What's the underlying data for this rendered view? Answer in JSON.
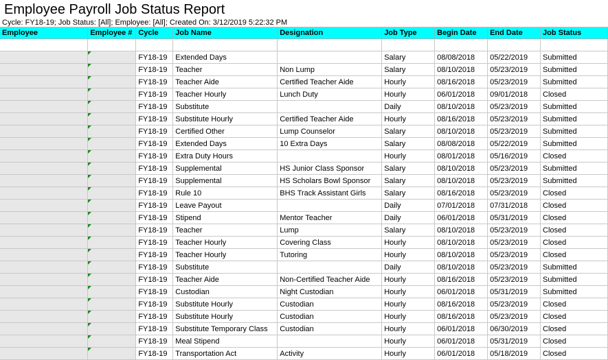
{
  "report": {
    "title": "Employee Payroll Job Status Report",
    "subtitle": "Cycle: FY18-19; Job Status: [All]; Employee: [All]; Created On: 3/12/2019 5:22:32 PM"
  },
  "columns": [
    "Employee",
    "Employee #",
    "Cycle",
    "Job Name",
    "Designation",
    "Job Type",
    "Begin Date",
    "End Date",
    "Job Status"
  ],
  "rows": [
    [
      "FY18-19",
      "Extended Days",
      "",
      "Salary",
      "08/08/2018",
      "05/22/2019",
      "Submitted"
    ],
    [
      "FY18-19",
      "Teacher",
      "Non Lump",
      "Salary",
      "08/10/2018",
      "05/23/2019",
      "Submitted"
    ],
    [
      "FY18-19",
      "Teacher Aide",
      "Certified Teacher Aide",
      "Hourly",
      "08/16/2018",
      "05/23/2019",
      "Submitted"
    ],
    [
      "FY18-19",
      "Teacher Hourly",
      "Lunch Duty",
      "Hourly",
      "06/01/2018",
      "09/01/2018",
      "Closed"
    ],
    [
      "FY18-19",
      "Substitute",
      "",
      "Daily",
      "08/10/2018",
      "05/23/2019",
      "Submitted"
    ],
    [
      "FY18-19",
      "Substitute Hourly",
      "Certified Teacher Aide",
      "Hourly",
      "08/16/2018",
      "05/23/2019",
      "Submitted"
    ],
    [
      "FY18-19",
      "Certified Other",
      "Lump Counselor",
      "Salary",
      "08/10/2018",
      "05/23/2019",
      "Submitted"
    ],
    [
      "FY18-19",
      "Extended Days",
      "10 Extra Days",
      "Salary",
      "08/08/2018",
      "05/22/2019",
      "Submitted"
    ],
    [
      "FY18-19",
      "Extra Duty Hours",
      "",
      "Hourly",
      "08/01/2018",
      "05/16/2019",
      "Closed"
    ],
    [
      "FY18-19",
      "Supplemental",
      "HS Junior Class Sponsor",
      "Salary",
      "08/10/2018",
      "05/23/2019",
      "Submitted"
    ],
    [
      "FY18-19",
      "Supplemental",
      "HS Scholars Bowl Sponsor",
      "Salary",
      "08/10/2018",
      "05/23/2019",
      "Submitted"
    ],
    [
      "FY18-19",
      "Rule 10",
      "BHS Track Assistant Girls",
      "Salary",
      "08/16/2018",
      "05/23/2019",
      "Closed"
    ],
    [
      "FY18-19",
      "Leave Payout",
      "",
      "Daily",
      "07/01/2018",
      "07/31/2018",
      "Closed"
    ],
    [
      "FY18-19",
      "Stipend",
      "Mentor Teacher",
      "Daily",
      "06/01/2018",
      "05/31/2019",
      "Closed"
    ],
    [
      "FY18-19",
      "Teacher",
      "Lump",
      "Salary",
      "08/10/2018",
      "05/23/2019",
      "Closed"
    ],
    [
      "FY18-19",
      "Teacher Hourly",
      "Covering Class",
      "Hourly",
      "08/10/2018",
      "05/23/2019",
      "Closed"
    ],
    [
      "FY18-19",
      "Teacher Hourly",
      "Tutoring",
      "Hourly",
      "08/10/2018",
      "05/23/2019",
      "Closed"
    ],
    [
      "FY18-19",
      "Substitute",
      "",
      "Daily",
      "08/10/2018",
      "05/23/2019",
      "Submitted"
    ],
    [
      "FY18-19",
      "Teacher Aide",
      "Non-Certified Teacher Aide",
      "Hourly",
      "08/16/2018",
      "05/23/2019",
      "Submitted"
    ],
    [
      "FY18-19",
      "Custodian",
      "Night Custodian",
      "Hourly",
      "06/01/2018",
      "05/31/2019",
      "Submitted"
    ],
    [
      "FY18-19",
      "Substitute Hourly",
      "Custodian",
      "Hourly",
      "08/16/2018",
      "05/23/2019",
      "Closed"
    ],
    [
      "FY18-19",
      "Substitute Hourly",
      "Custodian",
      "Hourly",
      "08/16/2018",
      "05/23/2019",
      "Closed"
    ],
    [
      "FY18-19",
      "Substitute Temporary Class",
      "Custodian",
      "Hourly",
      "06/01/2018",
      "06/30/2019",
      "Closed"
    ],
    [
      "FY18-19",
      "Meal Stipend",
      "",
      "Hourly",
      "06/01/2018",
      "05/31/2019",
      "Closed"
    ],
    [
      "FY18-19",
      "Transportation Act",
      "Activity",
      "Hourly",
      "06/01/2018",
      "05/18/2019",
      "Closed"
    ]
  ]
}
